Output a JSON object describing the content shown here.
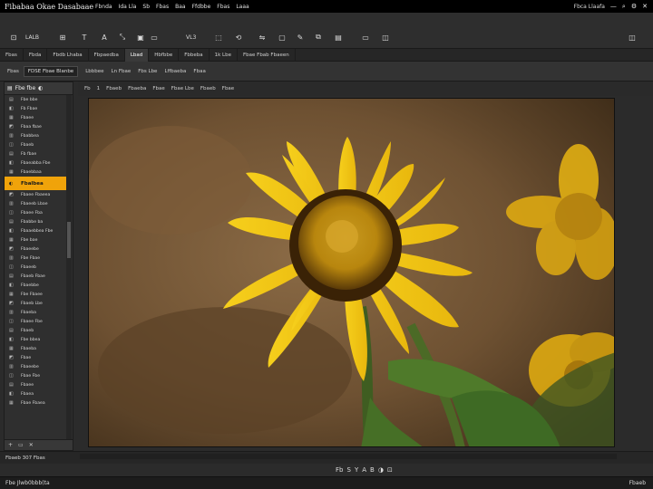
{
  "window": {
    "title": "Fibabaa Okae Dasabaae",
    "right_text": "Fbca Llaafa"
  },
  "menu": [
    "Fbnda",
    "Ida Lla",
    "Sb",
    "Fbas",
    "Baa",
    "Ffdbbe",
    "Fbas",
    "Laaa"
  ],
  "toolbar": {
    "tools": [
      {
        "icon": "crop-icon",
        "glyph": "⊡"
      },
      {
        "icon": "layers-icon",
        "label": "LALB"
      },
      {
        "icon": "grid-icon",
        "glyph": "⊞"
      },
      {
        "icon": "text-tool-icon",
        "glyph": "T"
      },
      {
        "icon": "text-a-icon",
        "glyph": "A"
      },
      {
        "icon": "transform-icon",
        "glyph": "⤡"
      },
      {
        "icon": "fill-icon",
        "glyph": "▣"
      },
      {
        "icon": "camera-icon",
        "glyph": "▭"
      },
      {
        "icon": "version-label",
        "label": "VL3"
      },
      {
        "icon": "select-icon",
        "glyph": "⬚"
      },
      {
        "icon": "rotate-icon",
        "glyph": "⟲"
      },
      {
        "icon": "transfer-icon",
        "glyph": "⇋"
      },
      {
        "icon": "frame-icon",
        "glyph": "▢"
      },
      {
        "icon": "wand-icon",
        "glyph": "✎"
      },
      {
        "icon": "stack-icon",
        "glyph": "⧉"
      },
      {
        "icon": "doc-icon",
        "glyph": "▤"
      },
      {
        "icon": "window-icon",
        "glyph": "▭"
      },
      {
        "icon": "panel-icon",
        "glyph": "◫"
      }
    ]
  },
  "tabs": [
    "Fbas",
    "Fbda",
    "Fbdb Lhaba",
    "Fbpaedba",
    "Lbad",
    "Hbfbbe",
    "Fbbeba",
    "1k Lbe",
    "Fbae Fbab Fbaeen"
  ],
  "active_tab": 4,
  "options": {
    "mode_label": "Fbas",
    "field1": "FDSE Fbae Blanbe",
    "opt1": "Lbbbee",
    "opt2": "Ln Fbae",
    "opt3": "Fbs Lbe",
    "opt4": "Lffbaeba",
    "opt5": "Fbaa"
  },
  "layers_panel": {
    "title": "Fbe fbe",
    "items": [
      "Fbe bbe",
      "Fb Fbae",
      "Fbaee",
      "Fbaa fbae",
      "Fbabbea",
      "Fbaeb",
      "Fb fbae",
      "Fbaeabba Fbe",
      "Fbaebbaa",
      "Fbaee Fbaeea",
      "Fbaeeb Lbae",
      "Fbaee Fba",
      "Fbabbe ba",
      "Fbaaebbea Fbe",
      "Fbe bae",
      "Fbaeebe",
      "Fbe Fbae",
      "Fbaeeb",
      "Fbaeb Fbae",
      "Fbaebbe",
      "Fbe Fbaee",
      "Fbaeb Lbe",
      "Fbaeba",
      "Fbaee Fbe",
      "Fbaeb",
      "Fbe bbea",
      "Fbaeba",
      "Fbae",
      "Fbaeebe",
      "Fbae Fbe",
      "Fbaee",
      "Fbaea",
      "Fbae Fbaea"
    ],
    "active_item": "Fbalbea",
    "active_index": 9
  },
  "viewbar": [
    "Fb",
    "1",
    "Fbaeb",
    "Fbaeba",
    "Fbae",
    "Fbae Lbe",
    "Fbaeb",
    "Fbae"
  ],
  "bottom": {
    "left_text": "Fbaeb 307 Fbas",
    "tools": [
      "Fb",
      "S",
      "Y",
      "A",
      "B",
      "◑",
      "⊡"
    ]
  },
  "status": {
    "left": "Fbe Jlwb0bbb(ta",
    "right": "Fbaeb"
  },
  "colors": {
    "accent": "#f0a30a",
    "panel": "#2f2f2f",
    "bg": "#2b2b2b"
  }
}
